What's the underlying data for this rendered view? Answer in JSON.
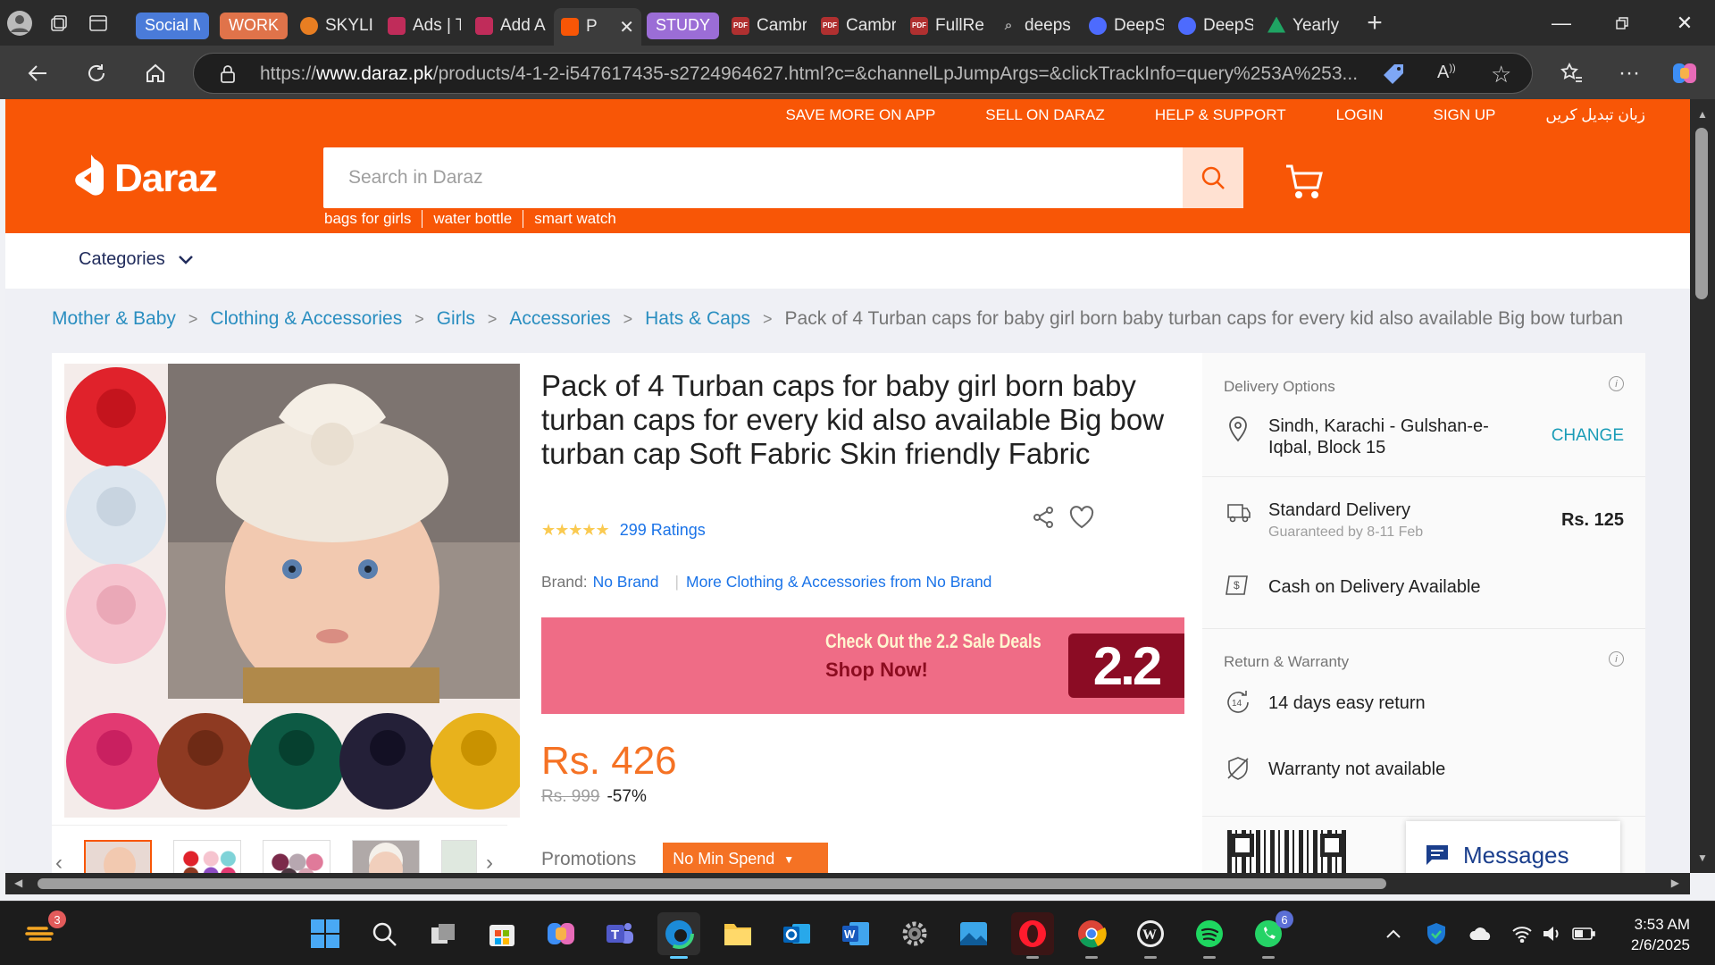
{
  "browser": {
    "tabs": [
      {
        "label": "Social M",
        "type": "group",
        "color": "#4a7bd9"
      },
      {
        "label": "WORK",
        "type": "group",
        "color": "#e0734a"
      },
      {
        "label": "SKYLIN",
        "type": "tab",
        "favicon_color": "#e87e22"
      },
      {
        "label": "Ads | T",
        "type": "tab",
        "favicon_color": "#c02c5a"
      },
      {
        "label": "Add A",
        "type": "tab",
        "favicon_color": "#c02c5a"
      },
      {
        "label": "P",
        "type": "active",
        "favicon_color": "#f85606"
      },
      {
        "label": "STUDY",
        "type": "group",
        "color": "#9b6dd6"
      },
      {
        "label": "Cambr",
        "type": "tab",
        "favicon_color": "#b03030"
      },
      {
        "label": "Cambr",
        "type": "tab",
        "favicon_color": "#b03030"
      },
      {
        "label": "FullRe",
        "type": "tab",
        "favicon_color": "#b03030"
      },
      {
        "label": "deeps",
        "type": "tab",
        "favicon_color": "#5a5a5a"
      },
      {
        "label": "DeepS",
        "type": "tab",
        "favicon_color": "#4d6bfe"
      },
      {
        "label": "DeepS",
        "type": "tab",
        "favicon_color": "#4d6bfe"
      },
      {
        "label": "Yearly",
        "type": "tab",
        "favicon_color": "#1fa463"
      }
    ],
    "url_prefix": "https://",
    "url_host": "www.daraz.pk",
    "url_path": "/products/4-1-2-i547617435-s2724964627.html?c=&channelLpJumpArgs=&clickTrackInfo=query%253A%253..."
  },
  "site": {
    "top_links": [
      "SAVE MORE ON APP",
      "SELL ON DARAZ",
      "HELP & SUPPORT",
      "LOGIN",
      "SIGN UP",
      "زبان تبدیل کریں"
    ],
    "logo_text": "Daraz",
    "search_placeholder": "Search in Daraz",
    "suggestions": [
      "bags for girls",
      "water bottle",
      "smart watch"
    ],
    "categories_label": "Categories",
    "brand_color": "#f85606"
  },
  "breadcrumb": [
    "Mother & Baby",
    "Clothing & Accessories",
    "Girls",
    "Accessories",
    "Hats & Caps"
  ],
  "breadcrumb_current": "Pack of 4 Turban caps for baby girl born baby turban caps for every kid also available Big bow turban",
  "product": {
    "title": "Pack of 4 Turban caps for baby girl born baby turban caps for every kid also available Big bow turban cap Soft Fabric Skin friendly Fabric",
    "stars": "★★★★★",
    "ratings": "299 Ratings",
    "brand_label": "Brand:",
    "brand": "No Brand",
    "more_from": "More Clothing & Accessories from No Brand",
    "banner_line1": "Check Out the 2.2 Sale Deals",
    "banner_line2": "Shop Now!",
    "banner_badge": "2.2",
    "price": "Rs. 426",
    "old_price": "Rs. 999",
    "discount": "-57%",
    "promotions_label": "Promotions",
    "promo_tag": "No Min Spend"
  },
  "delivery": {
    "section_title": "Delivery Options",
    "location": "Sindh, Karachi - Gulshan-e-Iqbal, Block 15",
    "change": "CHANGE",
    "standard": "Standard Delivery",
    "guaranteed": "Guaranteed by 8-11 Feb",
    "fee": "Rs. 125",
    "cod": "Cash on Delivery Available",
    "return_title": "Return & Warranty",
    "return": "14 days easy return",
    "warranty": "Warranty not available",
    "messages": "Messages"
  },
  "taskbar": {
    "weather_badge": "3",
    "whatsapp_badge": "6",
    "time": "3:53 AM",
    "date": "2/6/2025"
  }
}
